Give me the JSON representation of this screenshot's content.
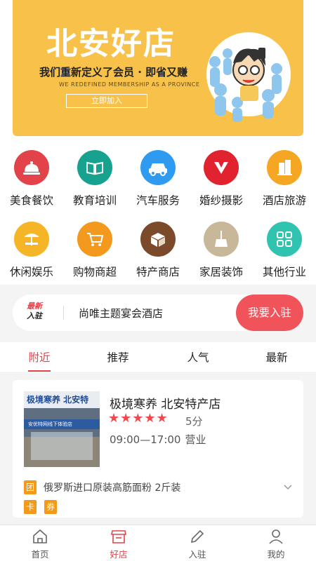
{
  "banner": {
    "title": "北安好店",
    "subtitle": "我们重新定义了会员 · 即省又赚",
    "subtitle_en": "WE REDEFINED MEMBERSHIP AS A PROVINCE",
    "join_label": "立即加入",
    "bg_color": "#f8c24a"
  },
  "categories": [
    {
      "label": "美食餐饮",
      "icon": "food-cloche-icon",
      "color": "#e2424a"
    },
    {
      "label": "教育培训",
      "icon": "book-icon",
      "color": "#16a28f"
    },
    {
      "label": "汽车服务",
      "icon": "car-icon",
      "color": "#2f9bf0"
    },
    {
      "label": "婚纱摄影",
      "icon": "wedding-heart-icon",
      "color": "#e0232f"
    },
    {
      "label": "酒店旅游",
      "icon": "building-icon",
      "color": "#f5a623"
    },
    {
      "label": "休闲娱乐",
      "icon": "beach-chair-icon",
      "color": "#f6b526"
    },
    {
      "label": "购物商超",
      "icon": "shopping-cart-icon",
      "color": "#f39a1e"
    },
    {
      "label": "特产商店",
      "icon": "gift-box-icon",
      "color": "#7a4a2a"
    },
    {
      "label": "家居装饰",
      "icon": "broom-icon",
      "color": "#c9b79a"
    },
    {
      "label": "其他行业",
      "icon": "grid-icon",
      "color": "#2fc3b0"
    }
  ],
  "notice": {
    "tag_line1": "最新",
    "tag_line2": "入驻",
    "text": "尚唯主题宴会酒店",
    "cta": "我要入驻"
  },
  "tabs": [
    {
      "label": "附近",
      "active": true
    },
    {
      "label": "推荐",
      "active": false
    },
    {
      "label": "人气",
      "active": false
    },
    {
      "label": "最新",
      "active": false
    }
  ],
  "shop": {
    "name": "极境寒养 北安特产店",
    "stars": "★★★★★",
    "rating": 5,
    "score_text": "5分",
    "hours": "09:00—17:00",
    "hours_suffix": "营业",
    "image_sign_text": "极境寒养 北安特",
    "image_banner_text": "安优特网线下体验店",
    "promo_badge": "团",
    "promo_text": "俄罗斯进口原装高筋面粉 2斤装",
    "badge_card": "卡",
    "badge_coupon": "券"
  },
  "nav": [
    {
      "label": "首页",
      "icon": "home-icon",
      "active": false
    },
    {
      "label": "好店",
      "icon": "shop-icon",
      "active": true
    },
    {
      "label": "入驻",
      "icon": "pencil-icon",
      "active": false
    },
    {
      "label": "我的",
      "icon": "user-icon",
      "active": false
    }
  ],
  "colors": {
    "accent": "#e2424a",
    "badge": "#f49a1a"
  }
}
